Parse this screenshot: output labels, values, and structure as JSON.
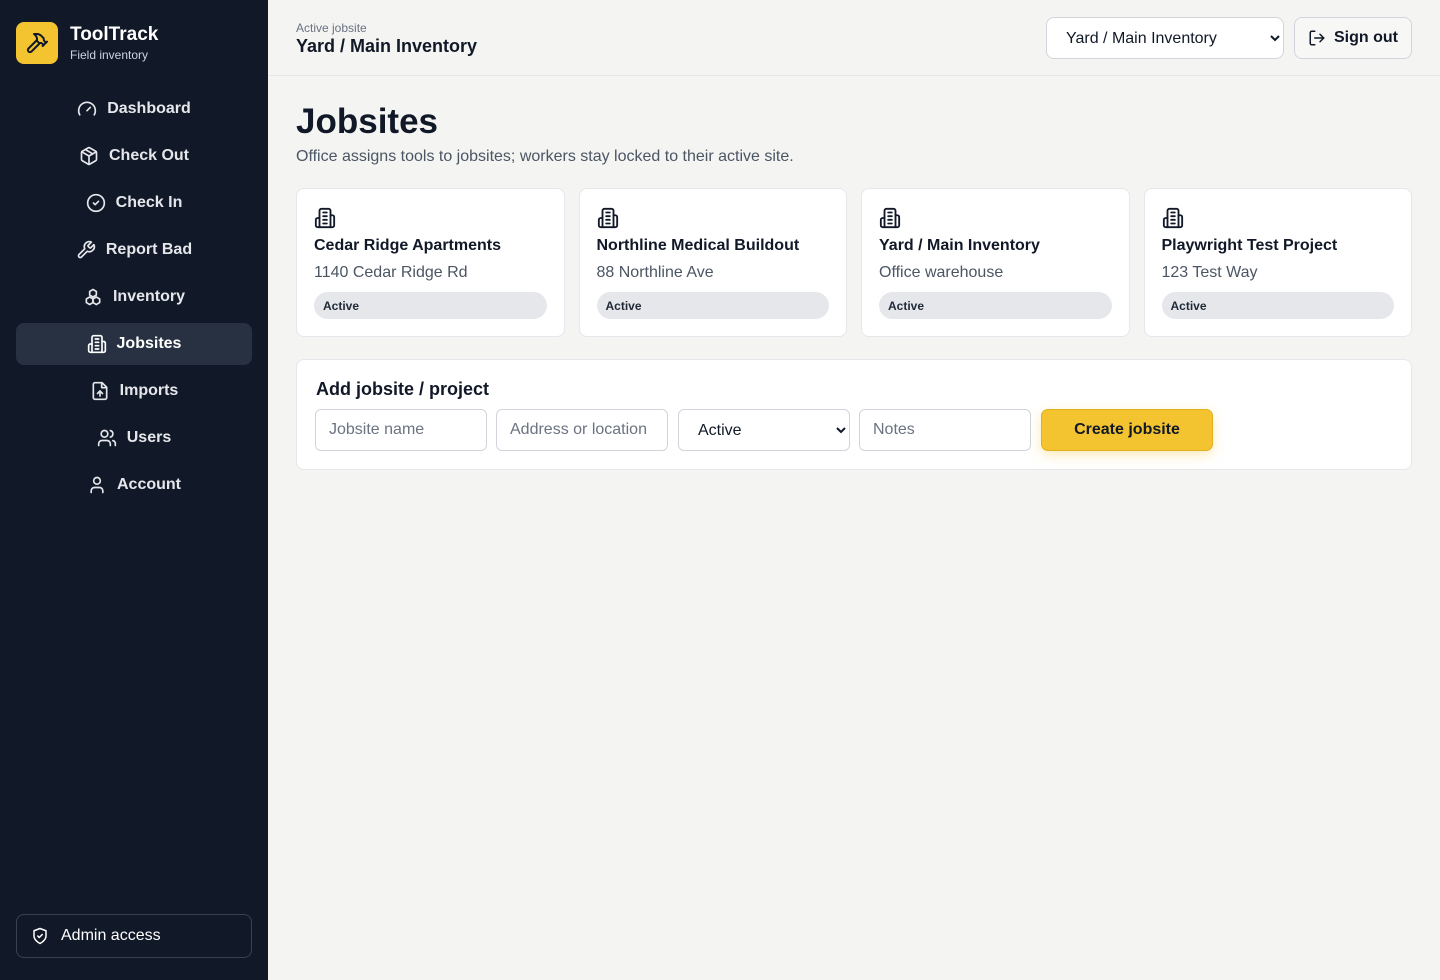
{
  "brand": {
    "name": "ToolTrack",
    "subtitle": "Field inventory",
    "logo_icon": "hammer-icon",
    "accent_color": "#f4c430"
  },
  "sidebar": {
    "background": "#111827",
    "items": [
      {
        "label": "Dashboard",
        "icon": "gauge-icon",
        "active": false
      },
      {
        "label": "Check Out",
        "icon": "package-icon",
        "active": false
      },
      {
        "label": "Check In",
        "icon": "check-circle-icon",
        "active": false
      },
      {
        "label": "Report Bad",
        "icon": "wrench-icon",
        "active": false
      },
      {
        "label": "Inventory",
        "icon": "boxes-icon",
        "active": false
      },
      {
        "label": "Jobsites",
        "icon": "building-icon",
        "active": true
      },
      {
        "label": "Imports",
        "icon": "file-upload-icon",
        "active": false
      },
      {
        "label": "Users",
        "icon": "users-icon",
        "active": false
      },
      {
        "label": "Account",
        "icon": "user-icon",
        "active": false
      }
    ],
    "admin_badge": {
      "label": "Admin access",
      "icon": "shield-check-icon"
    }
  },
  "header": {
    "active_label": "Active jobsite",
    "active_site": "Yard / Main Inventory",
    "site_select": {
      "selected": "Yard / Main Inventory",
      "options": [
        "Yard / Main Inventory"
      ]
    },
    "signout_label": "Sign out"
  },
  "main": {
    "title": "Jobsites",
    "subtitle": "Office assigns tools to jobsites; workers stay locked to their active site.",
    "jobsites": [
      {
        "name": "Cedar Ridge Apartments",
        "address": "1140 Cedar Ridge Rd",
        "status": "Active"
      },
      {
        "name": "Northline Medical Buildout",
        "address": "88 Northline Ave",
        "status": "Active"
      },
      {
        "name": "Yard / Main Inventory",
        "address": "Office warehouse",
        "status": "Active"
      },
      {
        "name": "Playwright Test Project",
        "address": "123 Test Way",
        "status": "Active"
      }
    ],
    "add_form": {
      "title": "Add jobsite / project",
      "name_placeholder": "Jobsite name",
      "address_placeholder": "Address or location",
      "status_selected": "Active",
      "status_options": [
        "Active"
      ],
      "notes_placeholder": "Notes",
      "submit_label": "Create jobsite"
    }
  }
}
